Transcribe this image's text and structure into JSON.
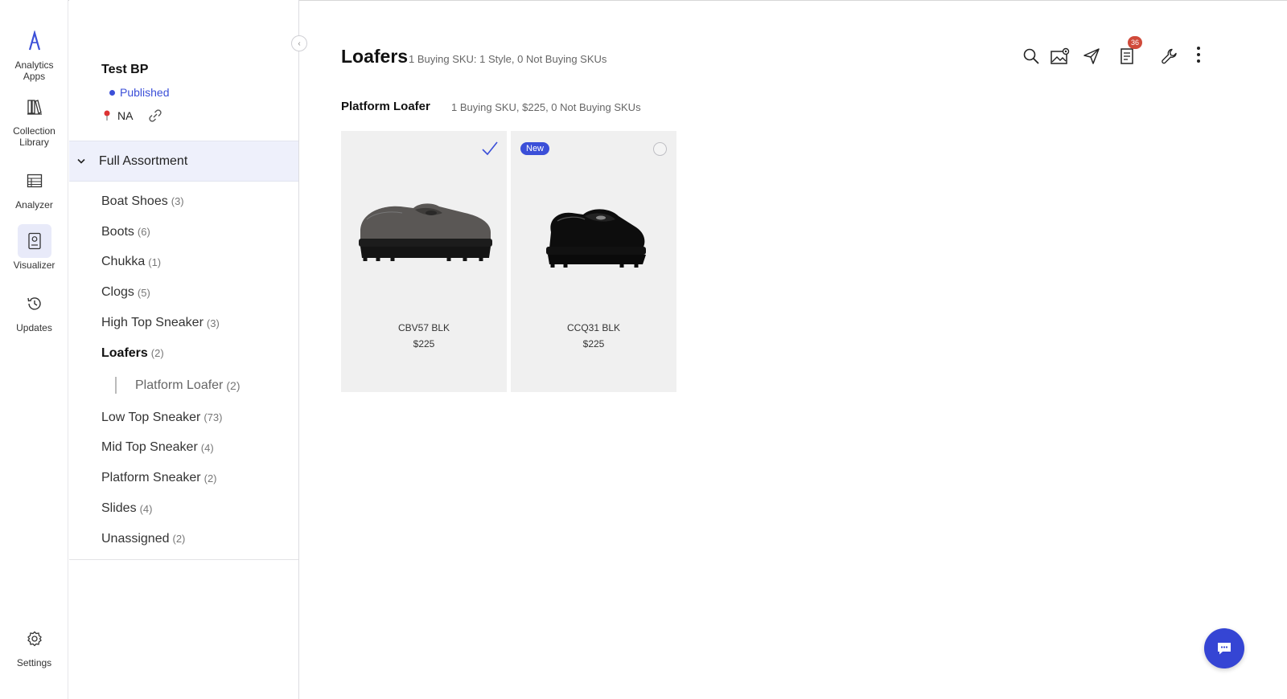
{
  "rail": {
    "items": [
      {
        "label_line1": "Analytics",
        "label_line2": "Apps",
        "icon": "analytics-logo-icon"
      },
      {
        "label_line1": "Collection",
        "label_line2": "Library",
        "icon": "library-icon"
      },
      {
        "label_line1": "Analyzer",
        "label_line2": "",
        "icon": "table-icon"
      },
      {
        "label_line1": "Visualizer",
        "label_line2": "",
        "icon": "visualizer-icon",
        "active": true
      },
      {
        "label_line1": "Updates",
        "label_line2": "",
        "icon": "history-icon"
      }
    ],
    "settings_label": "Settings"
  },
  "panel": {
    "bp_name": "Test BP",
    "status": "Published",
    "region": "NA",
    "full_assortment": "Full Assortment",
    "categories": [
      {
        "name": "Boat Shoes",
        "count": "(3)"
      },
      {
        "name": "Boots",
        "count": "(6)"
      },
      {
        "name": "Chukka",
        "count": "(1)"
      },
      {
        "name": "Clogs",
        "count": "(5)"
      },
      {
        "name": "High Top Sneaker",
        "count": "(3)"
      },
      {
        "name": "Loafers",
        "count": "(2)",
        "active": true
      },
      {
        "name": "Low Top Sneaker",
        "count": "(73)"
      },
      {
        "name": "Mid Top Sneaker",
        "count": "(4)"
      },
      {
        "name": "Platform Sneaker",
        "count": "(2)"
      },
      {
        "name": "Slides",
        "count": "(4)"
      },
      {
        "name": "Unassigned",
        "count": "(2)"
      }
    ],
    "subcategory": {
      "name": "Platform Loafer",
      "count": "(2)"
    }
  },
  "main": {
    "title": "Loafers",
    "title_sub": "1 Buying SKU: 1 Style, 0 Not Buying SKUs",
    "group_title": "Platform Loafer",
    "group_sub": "1 Buying SKU, $225, 0 Not Buying SKUs",
    "toolbar": {
      "notification_count": "36"
    },
    "products": [
      {
        "sku": "CBV57 BLK",
        "price": "$225",
        "selected": true,
        "new": false
      },
      {
        "sku": "CCQ31 BLK",
        "price": "$225",
        "selected": false,
        "new": true,
        "new_label": "New"
      }
    ]
  },
  "colors": {
    "accent": "#3b4fd8",
    "badge": "#d04a3a",
    "card_bg": "#f0f0f0"
  }
}
